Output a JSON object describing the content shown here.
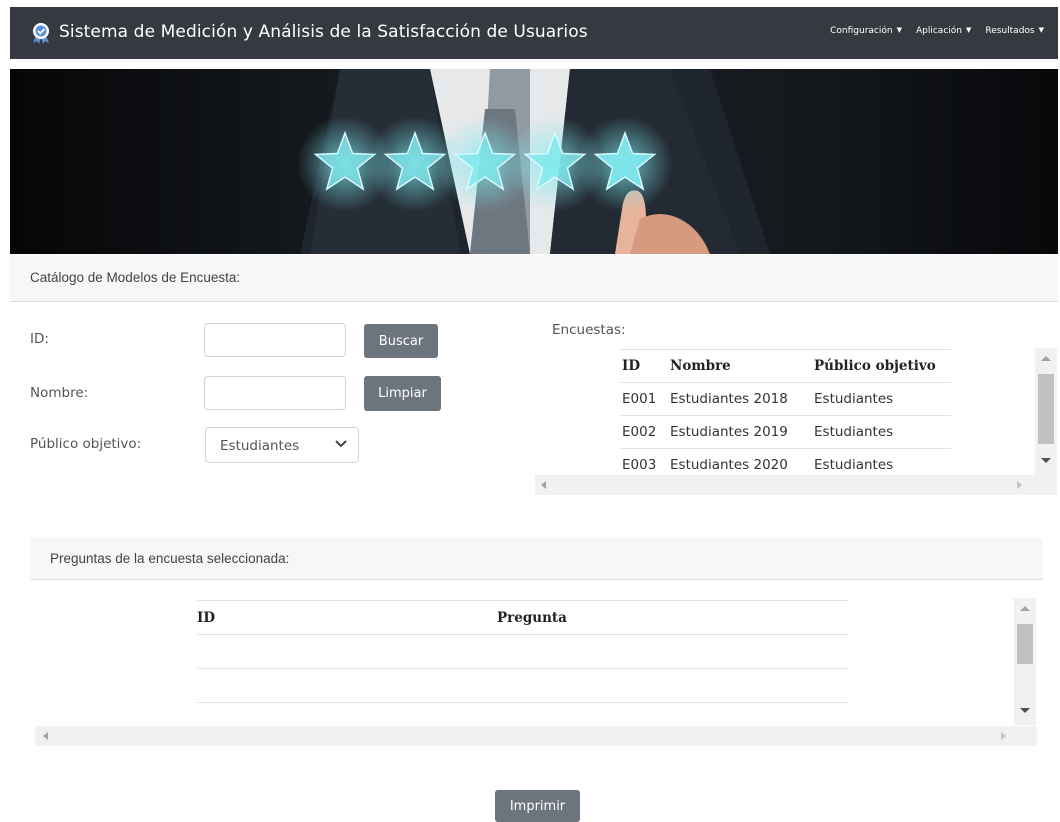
{
  "navbar": {
    "title": "Sistema de Medición y Análisis de la Satisfacción de Usuarios",
    "logo_icon": "award-badge-icon",
    "menu": [
      {
        "label": "Configuración"
      },
      {
        "label": "Aplicación"
      },
      {
        "label": "Resultados"
      }
    ],
    "background": "#343a40"
  },
  "hero": {
    "stars": 5,
    "star_color": "#7fe8ee"
  },
  "catalog": {
    "title": "Catálogo de Modelos de Encuesta:"
  },
  "form": {
    "id_label": "ID:",
    "id_value": "",
    "nombre_label": "Nombre:",
    "nombre_value": "",
    "publico_label": "Público objetivo:",
    "publico_value": "Estudiantes",
    "search_button": "Buscar",
    "clear_button": "Limpiar"
  },
  "encuestas": {
    "title": "Encuestas:",
    "columns": [
      "ID",
      "Nombre",
      "Público objetivo"
    ],
    "rows": [
      [
        "E001",
        "Estudiantes 2018",
        "Estudiantes"
      ],
      [
        "E002",
        "Estudiantes 2019",
        "Estudiantes"
      ],
      [
        "E003",
        "Estudiantes 2020",
        "Estudiantes"
      ]
    ]
  },
  "preguntas": {
    "title": "Preguntas de la encuesta seleccionada:",
    "columns": [
      "ID",
      "Pregunta"
    ],
    "rows": [
      [
        "",
        ""
      ],
      [
        "",
        ""
      ]
    ]
  },
  "print_button": "Imprimir",
  "colors": {
    "button": "#6c757d",
    "header_bg": "#f7f7f7"
  }
}
